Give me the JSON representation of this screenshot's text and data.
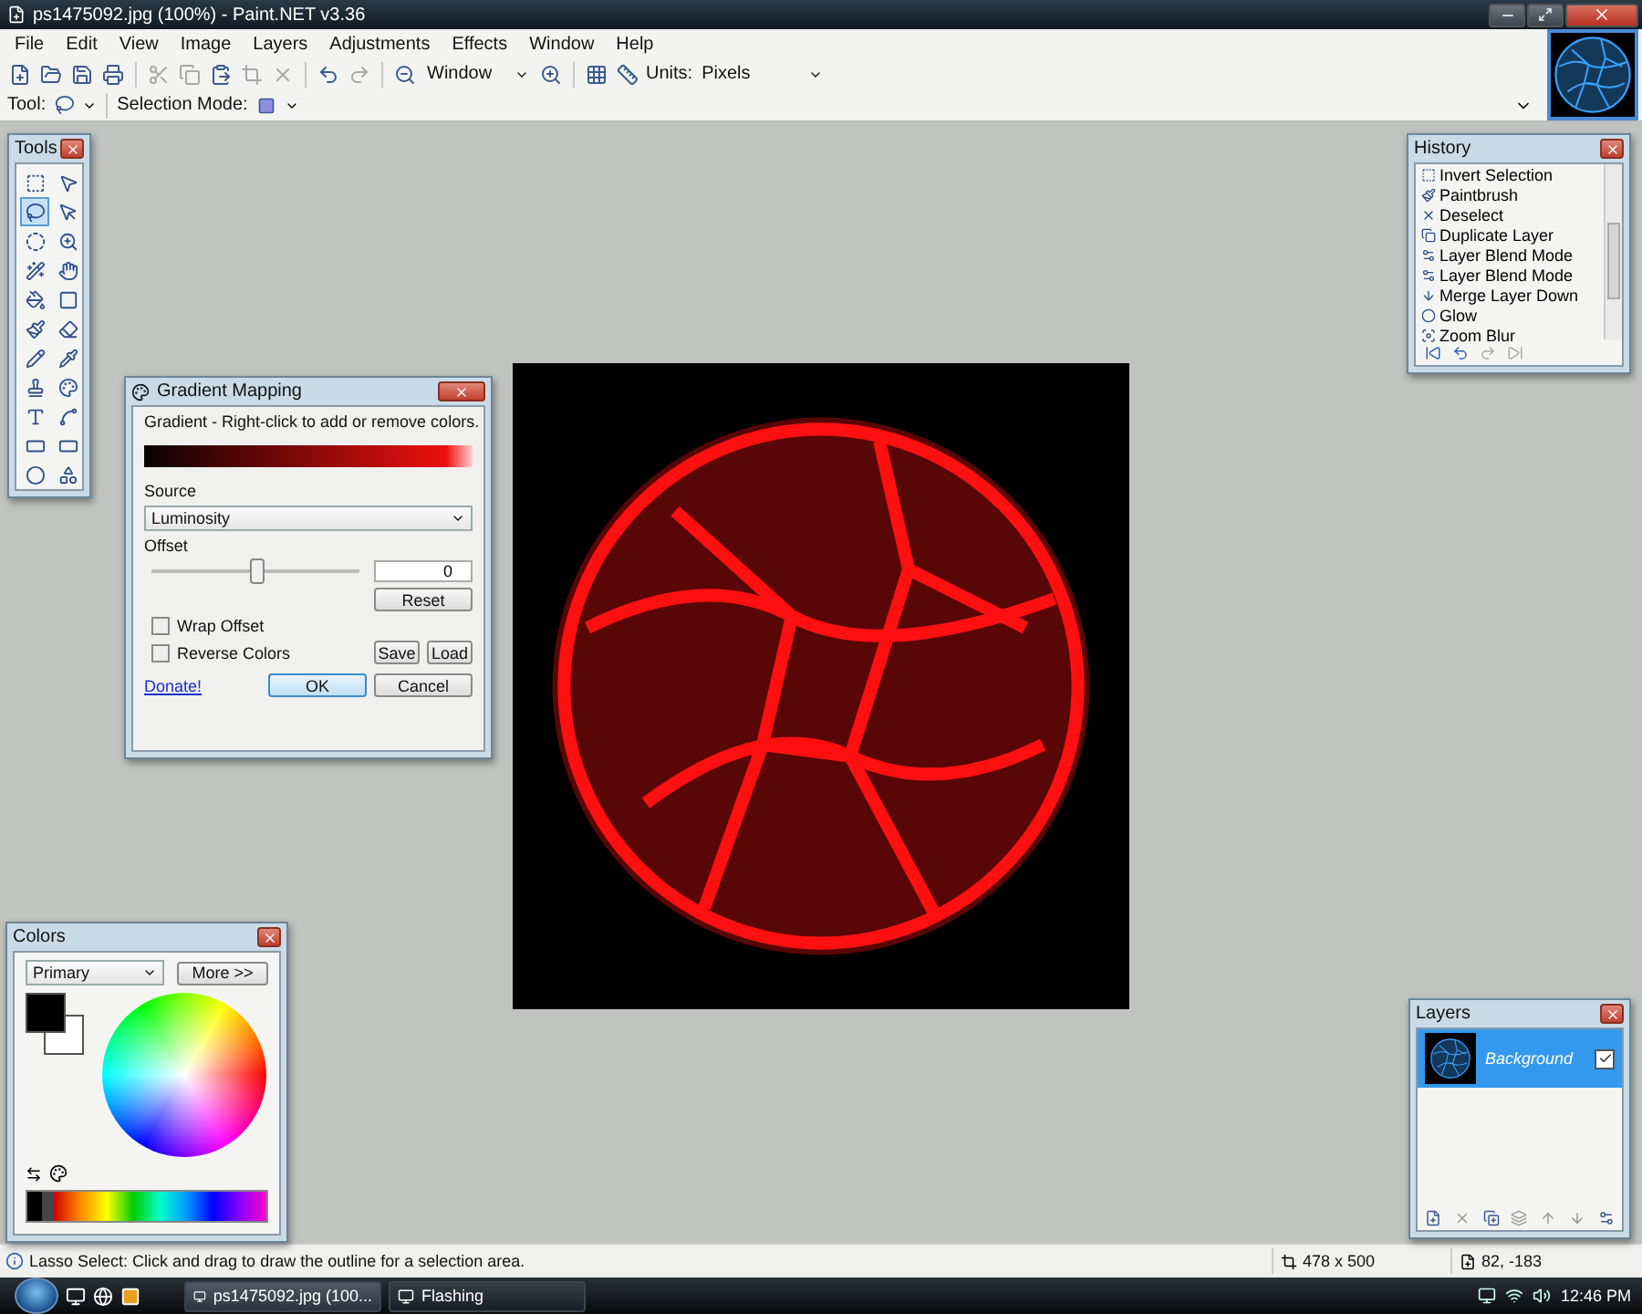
{
  "window": {
    "title": "ps1475092.jpg (100%) - Paint.NET v3.36"
  },
  "menu": [
    "File",
    "Edit",
    "View",
    "Image",
    "Layers",
    "Adjustments",
    "Effects",
    "Window",
    "Help"
  ],
  "toolbar": {
    "zoom_value": "Window",
    "units_label": "Units:",
    "units_value": "Pixels"
  },
  "tool_options": {
    "tool_label": "Tool:",
    "selection_mode_label": "Selection Mode:"
  },
  "tools_panel": {
    "title": "Tools",
    "tools": [
      {
        "kind": "rect-select",
        "selected": false
      },
      {
        "kind": "move-pixels",
        "selected": false
      },
      {
        "kind": "lasso",
        "selected": true
      },
      {
        "kind": "move-selection",
        "selected": false
      },
      {
        "kind": "ellipse-select",
        "selected": false
      },
      {
        "kind": "zoom",
        "selected": false
      },
      {
        "kind": "magic-wand",
        "selected": false
      },
      {
        "kind": "pan",
        "selected": false
      },
      {
        "kind": "bucket",
        "selected": false
      },
      {
        "kind": "gradient",
        "selected": false
      },
      {
        "kind": "brush",
        "selected": false
      },
      {
        "kind": "eraser",
        "selected": false
      },
      {
        "kind": "pencil",
        "selected": false
      },
      {
        "kind": "picker",
        "selected": false
      },
      {
        "kind": "stamp",
        "selected": false
      },
      {
        "kind": "recolor",
        "selected": false
      },
      {
        "kind": "text",
        "selected": false
      },
      {
        "kind": "line",
        "selected": false
      },
      {
        "kind": "rectangle",
        "selected": false
      },
      {
        "kind": "rounded-rect",
        "selected": false
      },
      {
        "kind": "ellipse",
        "selected": false
      },
      {
        "kind": "freeform",
        "selected": false
      }
    ]
  },
  "gradient_dialog": {
    "title": "Gradient Mapping",
    "hint": "Gradient - Right-click to add or remove colors.",
    "source_label": "Source",
    "source_value": "Luminosity",
    "offset_label": "Offset",
    "offset": {
      "level": 0.5
    },
    "offset_value": "0",
    "reset": "Reset",
    "options": [
      {
        "label": "Wrap Offset",
        "checked": false
      },
      {
        "label": "Reverse Colors",
        "checked": false
      }
    ],
    "save": "Save",
    "load": "Load",
    "donate": "Donate!",
    "ok": "OK",
    "cancel": "Cancel"
  },
  "history_panel": {
    "title": "History",
    "items": [
      {
        "label": "Invert Selection",
        "kind": "selection"
      },
      {
        "label": "Paintbrush",
        "kind": "brush"
      },
      {
        "label": "Deselect",
        "kind": "deselect"
      },
      {
        "label": "Duplicate Layer",
        "kind": "duplicate"
      },
      {
        "label": "Layer Blend Mode",
        "kind": "properties"
      },
      {
        "label": "Layer Blend Mode",
        "kind": "properties"
      },
      {
        "label": "Merge Layer Down",
        "kind": "merge"
      },
      {
        "label": "Glow",
        "kind": "glow"
      },
      {
        "label": "Zoom Blur",
        "kind": "blur"
      }
    ]
  },
  "colors_panel": {
    "title": "Colors",
    "mode": "Primary",
    "more": "More >>"
  },
  "layers_panel": {
    "title": "Layers",
    "layers": [
      {
        "name": "Background",
        "selected": true,
        "visible": true
      }
    ]
  },
  "status_bar": {
    "text": "Lasso Select: Click and drag to draw the outline for a selection area.",
    "image_size": "478 x 500",
    "cursor": "82, -183"
  },
  "taskbar": {
    "tasks": [
      {
        "label": "ps1475092.jpg (100...",
        "selected": true
      },
      {
        "label": "Flashing",
        "selected": false
      }
    ],
    "clock": "12:46 PM"
  }
}
